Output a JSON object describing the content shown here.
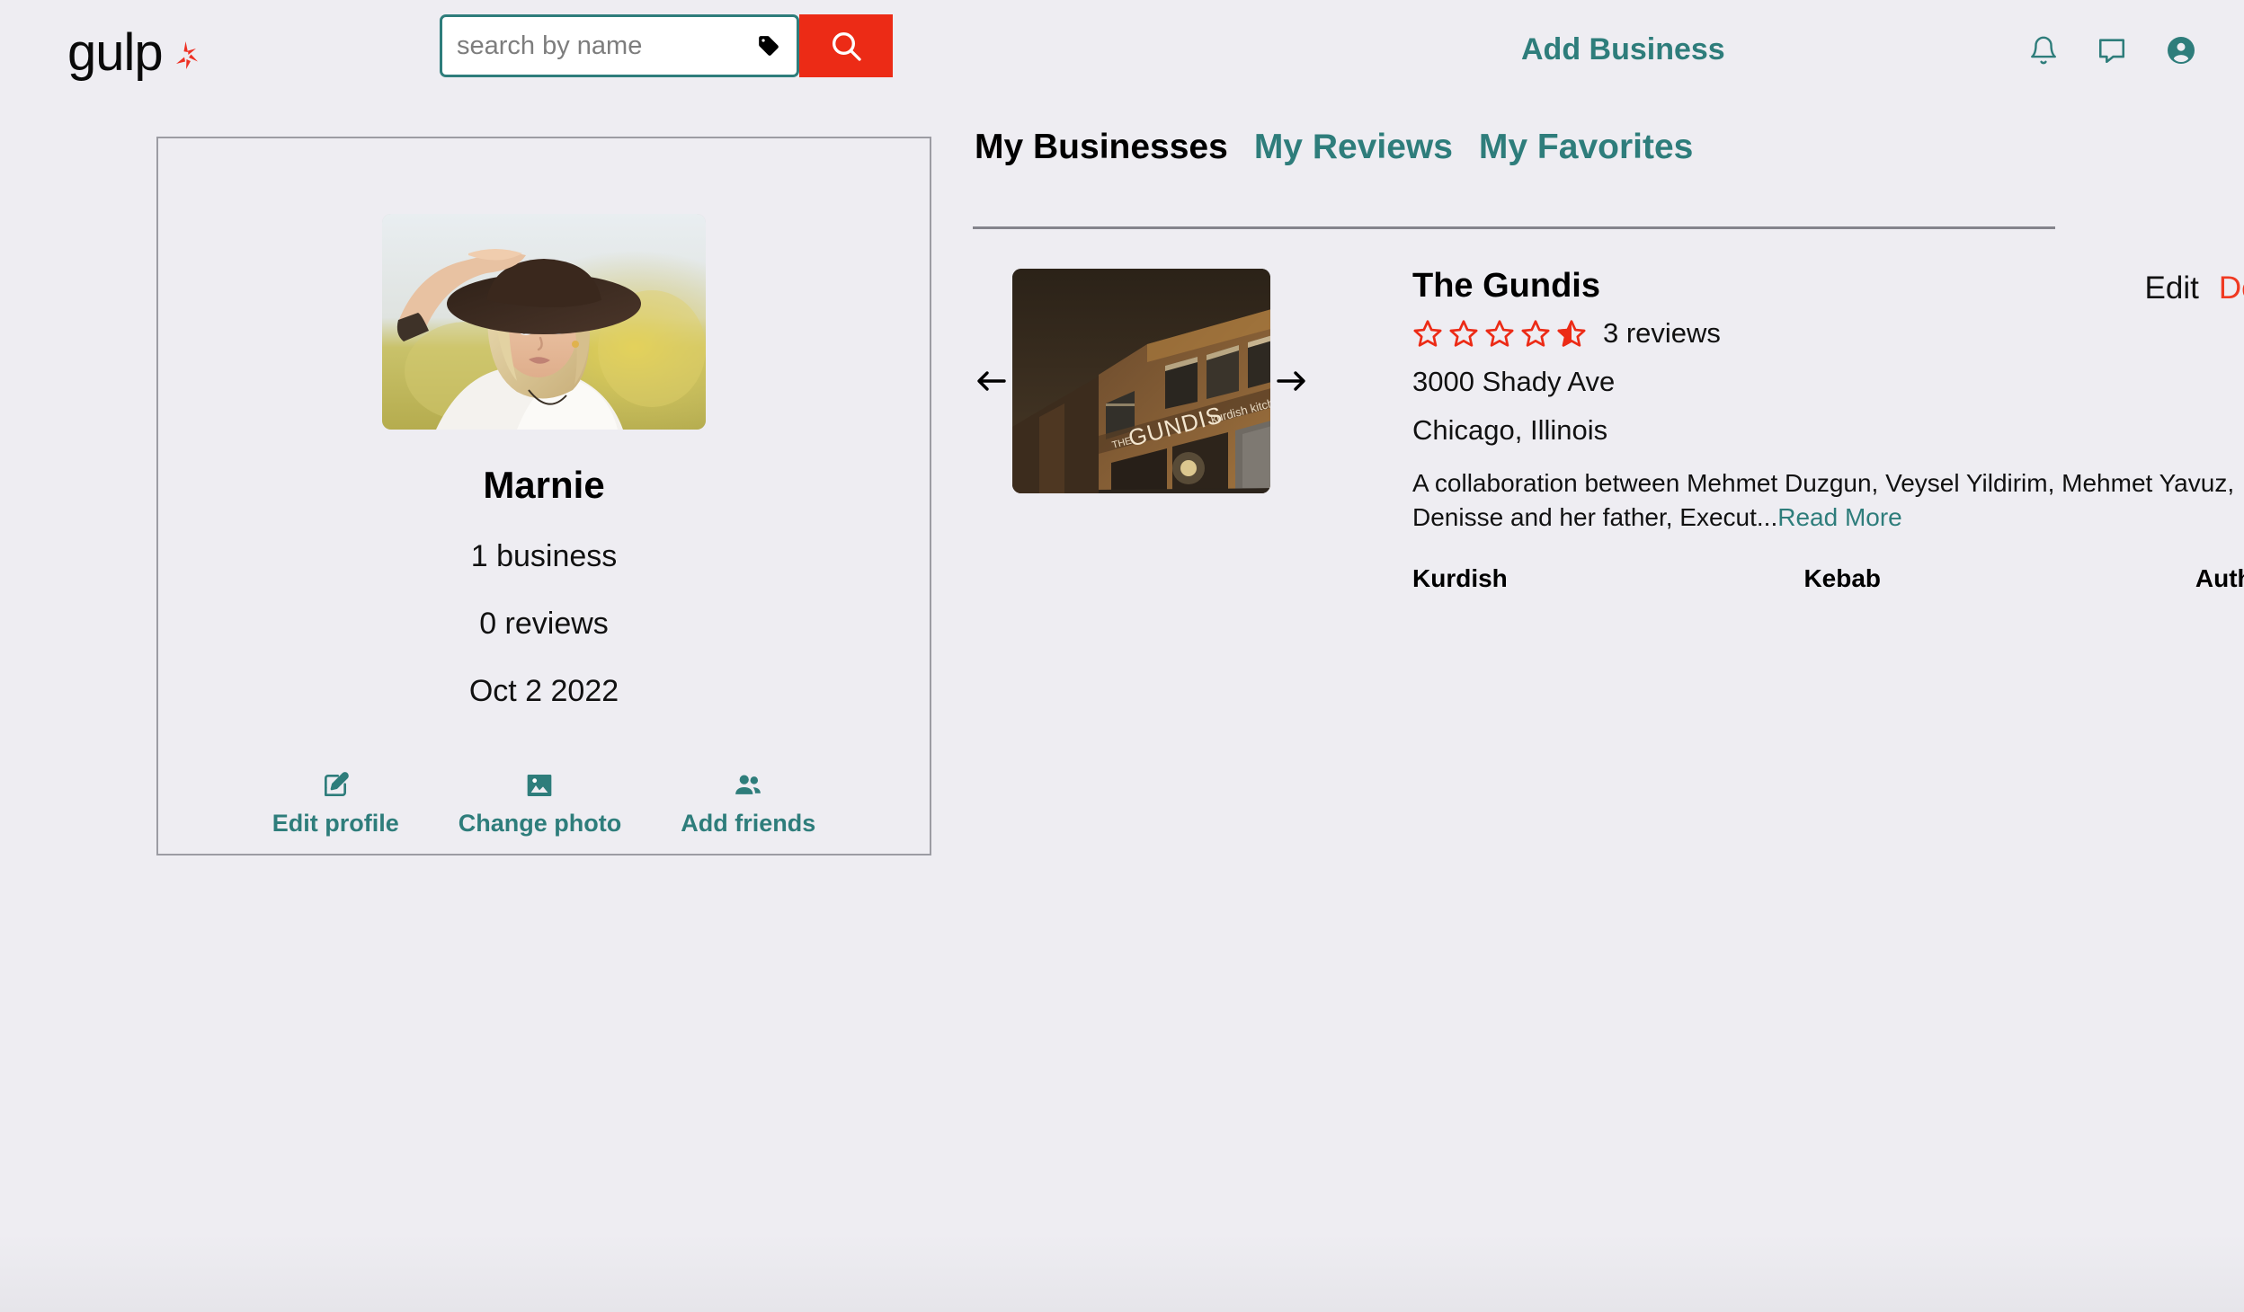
{
  "header": {
    "logo_text": "gulp",
    "logo_icon": "yelp-burst-icon",
    "search": {
      "placeholder": "search by name",
      "value": "",
      "tag_icon": "tag-icon",
      "button_icon": "search-icon"
    },
    "add_business_label": "Add Business",
    "icons": [
      {
        "name": "bell-icon",
        "label": "Notifications"
      },
      {
        "name": "chat-icon",
        "label": "Messages"
      },
      {
        "name": "account-circle-icon",
        "label": "Account"
      }
    ]
  },
  "profile": {
    "avatar_alt": "Profile photo of woman in wide-brim hat",
    "name": "Marnie",
    "business_count": "1 business",
    "review_count": "0 reviews",
    "joined_date": "Oct 2 2022",
    "actions": [
      {
        "icon": "edit-square-icon",
        "label": "Edit profile"
      },
      {
        "icon": "image-icon",
        "label": "Change photo"
      },
      {
        "icon": "people-icon",
        "label": "Add friends"
      }
    ]
  },
  "main": {
    "tabs": [
      {
        "label": "My Businesses",
        "active": true
      },
      {
        "label": "My Reviews",
        "active": false
      },
      {
        "label": "My Favorites",
        "active": false
      }
    ],
    "businesses": [
      {
        "name": "The Gundis",
        "photo_alt": "The Gundis kurdish kitchen storefront at night",
        "rating": 0.5,
        "stars_total": 5,
        "review_count": "3 reviews",
        "address": "3000 Shady Ave",
        "city_state": "Chicago, Illinois",
        "description": "A collaboration between Mehmet Duzgun, Veysel Yildirim, Mehmet Yavuz, Denisse and her father, Execut...",
        "read_more_label": "Read More",
        "tags": [
          "Kurdish",
          "Kebab",
          "Authentic"
        ],
        "edit_label": "Edit",
        "delete_label": "Delete",
        "prev_arrow": "arrow-left-icon",
        "next_arrow": "arrow-right-icon"
      }
    ]
  },
  "colors": {
    "accent_teal": "#2e7d7b",
    "accent_red": "#ec2b16",
    "delete_red": "#f03a22",
    "page_bg": "#eeedf2",
    "border_gray": "#9c9ca3"
  }
}
